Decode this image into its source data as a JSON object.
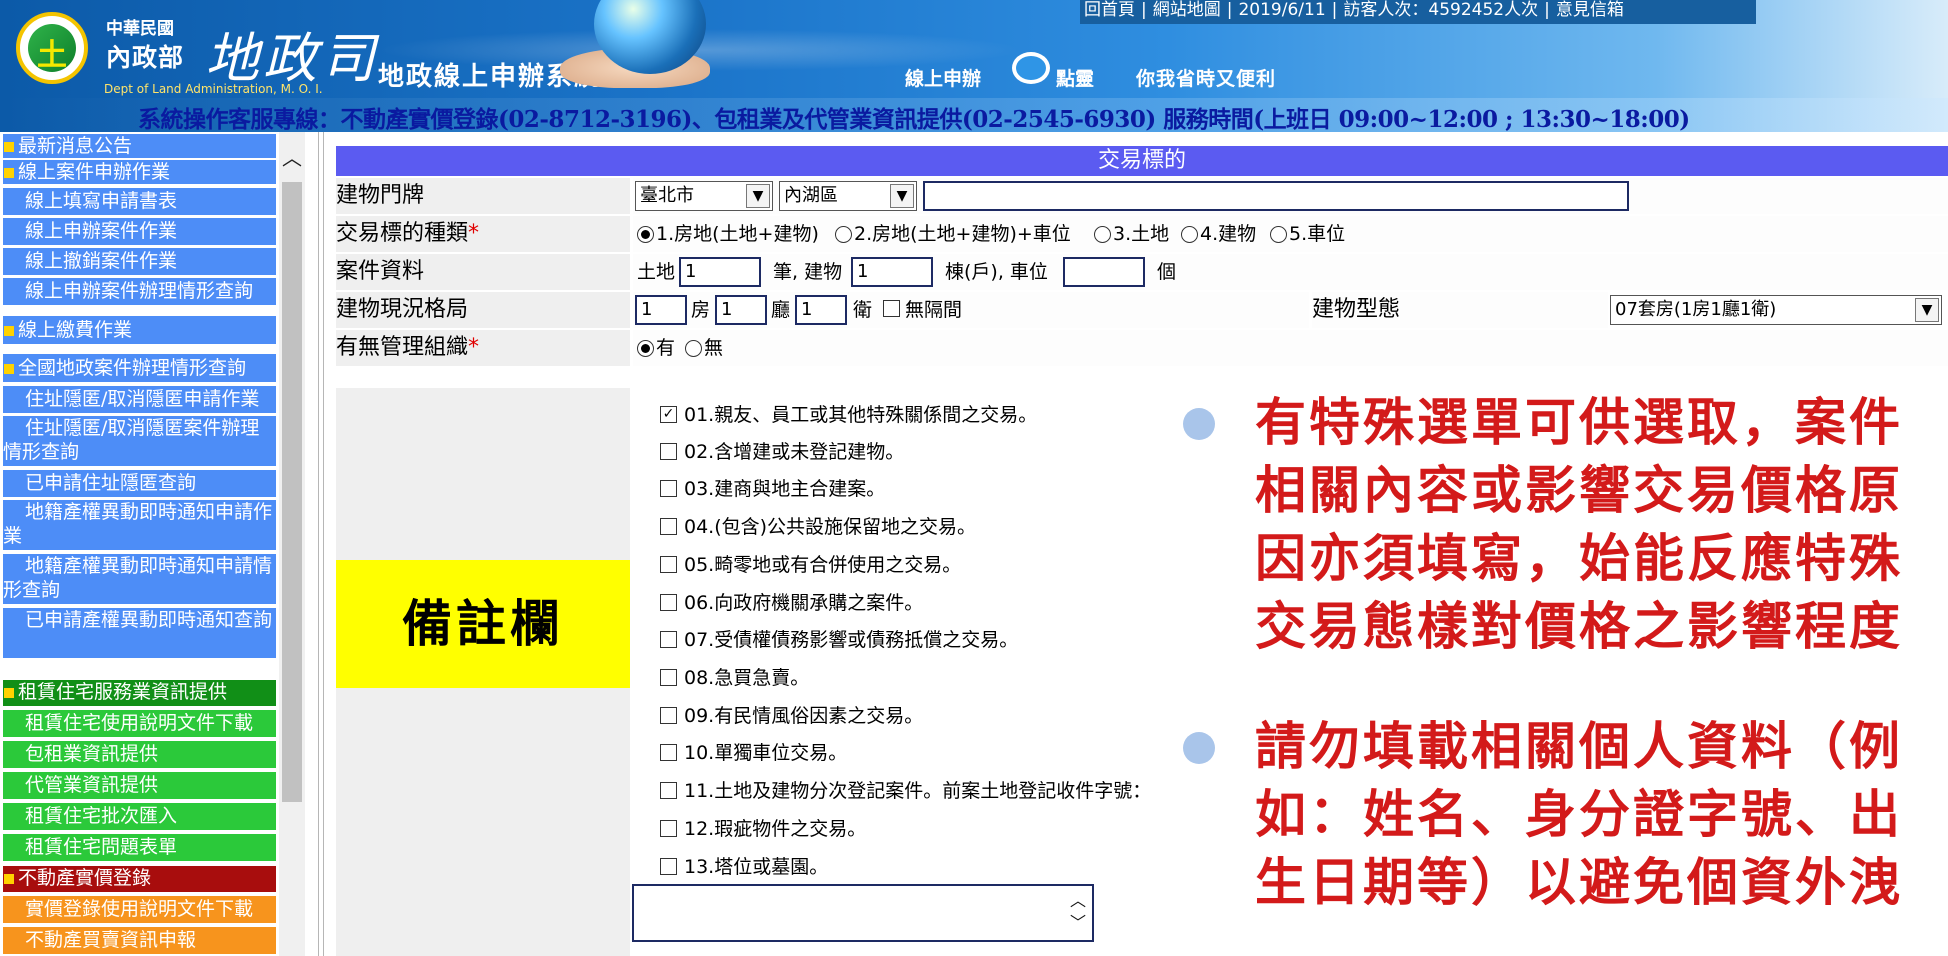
{
  "header": {
    "org_small": "中華民國",
    "ministry": "內政部",
    "department": "地政司",
    "department_en": "Dept of Land Administration, M. O. I.",
    "system_title": "地政線上申辦系統",
    "slogan_a": "線上申辦",
    "slogan_b": "點靈",
    "slogan_c": "你我省時又便利",
    "top_links": [
      "回首頁",
      "網站地圖",
      "2019/6/11",
      "訪客人次：4592452人次",
      "意見信箱"
    ],
    "hotline": "系統操作客服專線：不動產實價登錄(02-8712-3196)、包租業及代管業資訊提供(02-2545-6930) 服務時間(上班日 09:00~12:00 ; 13:30~18:00)"
  },
  "sidebar": {
    "items": [
      {
        "label": "最新消息公告",
        "style": "blue",
        "bullet": true
      },
      {
        "label": "線上案件申辦作業",
        "style": "blue",
        "bullet": true
      },
      {
        "label": "線上填寫申請書表",
        "style": "blue",
        "bullet": false
      },
      {
        "label": "線上申辦案件作業",
        "style": "blue",
        "bullet": false
      },
      {
        "label": "線上撤銷案件作業",
        "style": "blue",
        "bullet": false
      },
      {
        "label": "線上申辦案件辦理情形查詢",
        "style": "blue",
        "bullet": false
      },
      {
        "label": "線上繳費作業",
        "style": "blue",
        "bullet": true
      },
      {
        "label": "全國地政案件辦理情形查詢",
        "style": "blue",
        "bullet": true
      },
      {
        "label": "住址隱匿/取消隱匿申請作業",
        "style": "blue",
        "bullet": false
      },
      {
        "label": "住址隱匿/取消隱匿案件辦理情形查詢",
        "style": "blue",
        "bullet": false
      },
      {
        "label": "已申請住址隱匿查詢",
        "style": "blue",
        "bullet": false
      },
      {
        "label": "地籍產權異動即時通知申請作業",
        "style": "blue",
        "bullet": false
      },
      {
        "label": "地籍產權異動即時通知申請情形查詢",
        "style": "blue",
        "bullet": false
      },
      {
        "label": "已申請產權異動即時通知查詢",
        "style": "blue",
        "bullet": false
      },
      {
        "label": "租賃住宅服務業資訊提供",
        "style": "darkgreen",
        "bullet": true
      },
      {
        "label": "租賃住宅使用說明文件下載",
        "style": "green",
        "bullet": false
      },
      {
        "label": "包租業資訊提供",
        "style": "green",
        "bullet": false
      },
      {
        "label": "代管業資訊提供",
        "style": "green",
        "bullet": false
      },
      {
        "label": "租賃住宅批次匯入",
        "style": "green",
        "bullet": false
      },
      {
        "label": "租賃住宅問題表單",
        "style": "green",
        "bullet": false
      },
      {
        "label": "不動產實價登錄",
        "style": "darkred",
        "bullet": true
      },
      {
        "label": "實價登錄使用說明文件下載",
        "style": "orange",
        "bullet": false
      },
      {
        "label": "不動產買賣資訊申報",
        "style": "orange",
        "bullet": false
      }
    ]
  },
  "form": {
    "section_title": "交易標的",
    "building_address": {
      "label": "建物門牌",
      "city": "臺北市",
      "district": "內湖區",
      "street_value": ""
    },
    "transaction_type": {
      "label": "交易標的種類",
      "required_mark": "*",
      "options": [
        "1.房地(土地+建物)",
        "2.房地(土地+建物)+車位",
        "3.土地",
        "4.建物",
        "5.車位"
      ],
      "selected_index": 0
    },
    "case_info": {
      "label": "案件資料",
      "land_prefix": "土地",
      "land_value": "1",
      "land_unit": "筆, 建物",
      "building_value": "1",
      "building_unit": "棟(戶), 車位",
      "parking_value": "",
      "parking_unit": "個"
    },
    "layout": {
      "label": "建物現況格局",
      "rooms": "1",
      "rooms_unit": "房",
      "halls": "1",
      "halls_unit": "廳",
      "baths": "1",
      "baths_unit": "衛",
      "no_partition_label": "無隔間",
      "no_partition_checked": false,
      "type_label": "建物型態",
      "type_value": "07套房(1房1廳1衛)"
    },
    "management": {
      "label": "有無管理組織",
      "required_mark": "*",
      "options": [
        "有",
        "無"
      ],
      "selected_index": 0
    },
    "remarks": {
      "label": "備註欄",
      "options": [
        {
          "label": "01.親友、員工或其他特殊關係間之交易。",
          "checked": true
        },
        {
          "label": "02.含增建或未登記建物。",
          "checked": false
        },
        {
          "label": "03.建商與地主合建案。",
          "checked": false
        },
        {
          "label": "04.(包含)公共設施保留地之交易。",
          "checked": false
        },
        {
          "label": "05.畸零地或有合併使用之交易。",
          "checked": false
        },
        {
          "label": "06.向政府機關承購之案件。",
          "checked": false
        },
        {
          "label": "07.受債權債務影響或債務抵償之交易。",
          "checked": false
        },
        {
          "label": "08.急買急賣。",
          "checked": false
        },
        {
          "label": "09.有民情風俗因素之交易。",
          "checked": false
        },
        {
          "label": "10.單獨車位交易。",
          "checked": false
        },
        {
          "label": "11.土地及建物分次登記案件。前案土地登記收件字號：",
          "checked": false
        },
        {
          "label": "12.瑕疵物件之交易。",
          "checked": false
        },
        {
          "label": "13.塔位或墓園。",
          "checked": false
        }
      ],
      "text_value": ""
    }
  },
  "annotations": {
    "note_1": [
      "有特殊選單可供選取，案件",
      "相關內容或影響交易價格原",
      "因亦須填寫，始能反應特殊",
      "交易態樣對價格之影響程度"
    ],
    "note_2": [
      "請勿填載相關個人資料（例",
      "如：姓名、身分證字號、出",
      "生日期等）以避免個資外洩"
    ],
    "note_color": "#d31a1a"
  }
}
